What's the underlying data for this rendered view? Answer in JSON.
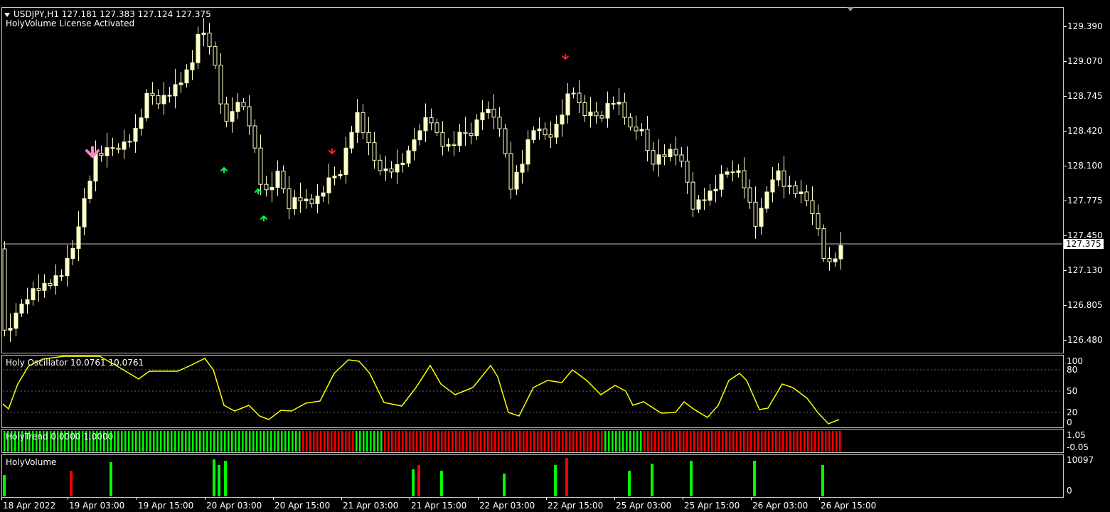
{
  "main": {
    "symbol_line": "USDJPY,H1  127.181 127.383 127.124 127.375",
    "license_text": "HolyVolume License Activated",
    "price_labels": [
      "129.390",
      "129.070",
      "128.745",
      "128.420",
      "128.100",
      "127.775",
      "127.450",
      "127.130",
      "126.805",
      "126.480"
    ],
    "current_price": "127.375",
    "candle_color": "#ffffc8"
  },
  "oscillator": {
    "title": "Holy Oscillator 10.0761 10.0761",
    "levels": [
      "100",
      "80",
      "50",
      "20",
      "0"
    ],
    "line_color": "#ffff00"
  },
  "trend": {
    "title": "HolyTrend 0.0000 1.0000",
    "levels": [
      "1.05",
      "-0.05"
    ],
    "up_color": "#00ff00",
    "down_color": "#ff0000"
  },
  "volume": {
    "title": "HolyVolume",
    "levels": [
      "10097",
      "0"
    ]
  },
  "time_axis": [
    "18 Apr 2022",
    "19 Apr 03:00",
    "19 Apr 15:00",
    "20 Apr 03:00",
    "20 Apr 15:00",
    "21 Apr 03:00",
    "21 Apr 15:00",
    "22 Apr 03:00",
    "22 Apr 15:00",
    "25 Apr 03:00",
    "25 Apr 15:00",
    "26 Apr 03:00",
    "26 Apr 15:00"
  ]
}
